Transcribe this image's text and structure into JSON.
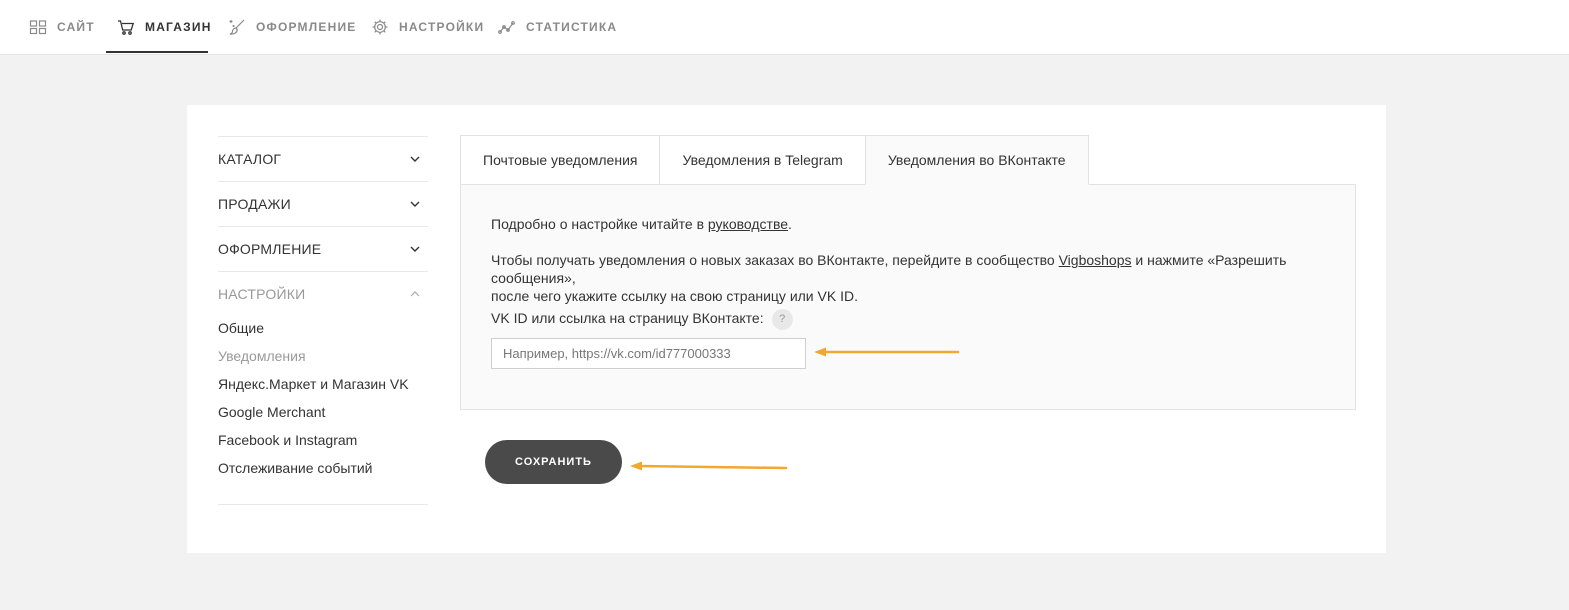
{
  "topnav": {
    "items": [
      {
        "label": "САЙТ",
        "icon": "grid-icon"
      },
      {
        "label": "МАГАЗИН",
        "icon": "cart-icon"
      },
      {
        "label": "ОФОРМЛЕНИЕ",
        "icon": "brush-icon"
      },
      {
        "label": "НАСТРОЙКИ",
        "icon": "gear-icon"
      },
      {
        "label": "СТАТИСТИКА",
        "icon": "chart-icon"
      }
    ],
    "active_index": 1
  },
  "sidebar": {
    "sections": [
      {
        "label": "КАТАЛОГ"
      },
      {
        "label": "ПРОДАЖИ"
      },
      {
        "label": "ОФОРМЛЕНИЕ"
      },
      {
        "label": "НАСТРОЙКИ"
      }
    ],
    "settings_items": [
      {
        "label": "Общие"
      },
      {
        "label": "Уведомления"
      },
      {
        "label": "Яндекс.Маркет и Магазин VK"
      },
      {
        "label": "Google Merchant"
      },
      {
        "label": "Facebook и Instagram"
      },
      {
        "label": "Отслеживание событий"
      }
    ]
  },
  "tabs": [
    {
      "label": "Почтовые уведомления"
    },
    {
      "label": "Уведомления в Telegram"
    },
    {
      "label": "Уведомления во ВКонтакте"
    }
  ],
  "panel": {
    "intro_prefix": "Подробно о настройке читайте в ",
    "intro_link": "руководстве",
    "intro_suffix": ".",
    "desc_prefix": "Чтобы получать уведомления о новых заказах во ВКонтакте, перейдите в сообщество ",
    "desc_link": "Vigboshops",
    "desc_suffix": " и нажмите «Разрешить сообщения»,",
    "desc_line2": "после чего укажите ссылку на свою страницу или VK ID.",
    "field_label": "VK ID или ссылка на страницу ВКонтакте:",
    "help": "?",
    "input_placeholder": "Например, https://vk.com/id777000333",
    "input_value": ""
  },
  "save_button": "СОХРАНИТЬ",
  "colors": {
    "arrow": "#f0a830",
    "button": "#4a4a4a",
    "page_bg": "#f2f2f2"
  }
}
